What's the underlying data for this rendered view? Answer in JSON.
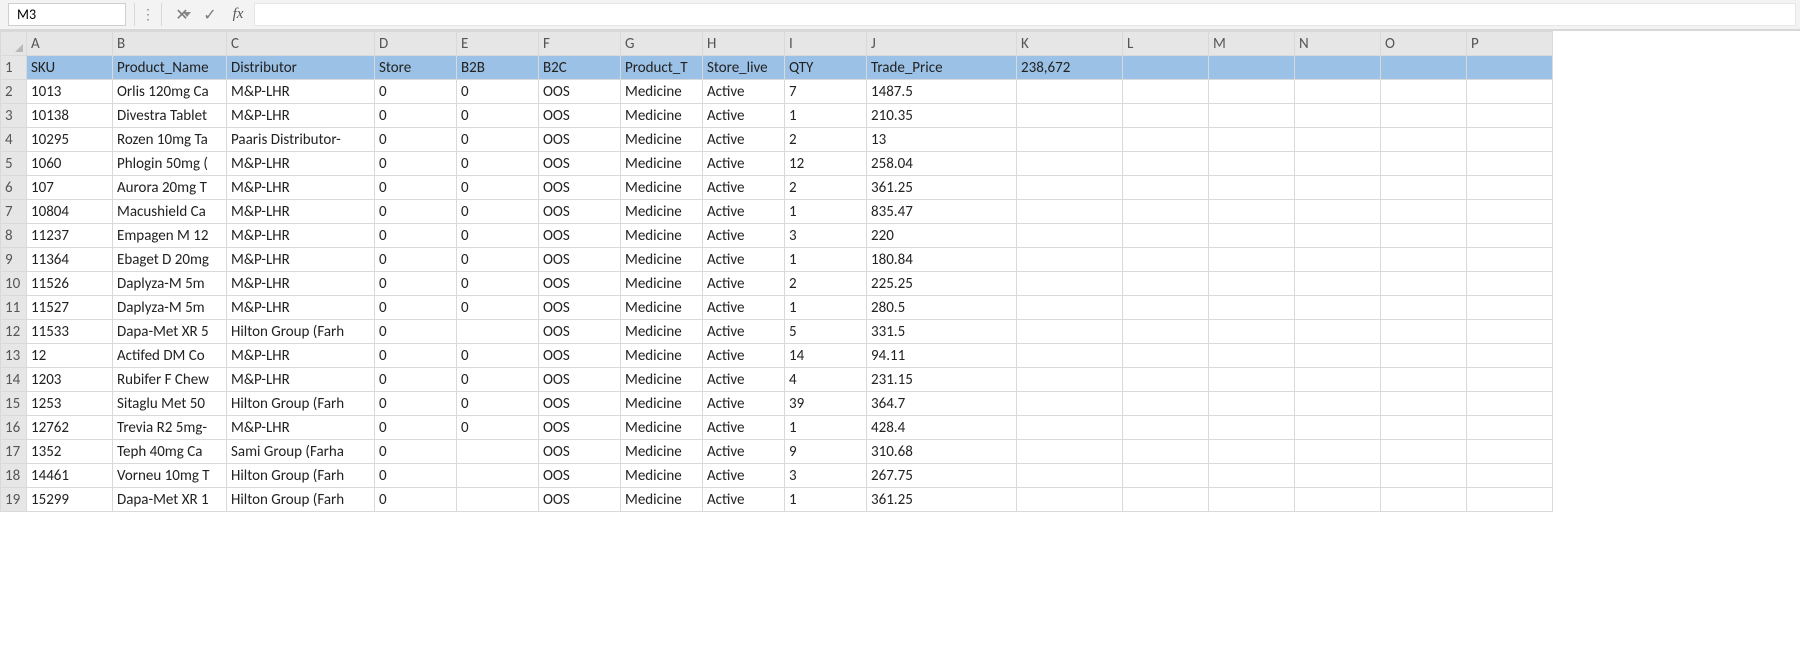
{
  "formula_bar": {
    "name_box_value": "M3",
    "cancel_glyph": "✕",
    "enter_glyph": "✓",
    "fx_label": "fx",
    "formula_value": ""
  },
  "columns": [
    "A",
    "B",
    "C",
    "D",
    "E",
    "F",
    "G",
    "H",
    "I",
    "J",
    "K",
    "L",
    "M",
    "N",
    "O",
    "P"
  ],
  "header_row": {
    "A": "SKU",
    "B": "Product_Name",
    "C": "Distributor",
    "D": "Store",
    "E": "B2B",
    "F": "B2C",
    "G": "Product_T",
    "H": "Store_live",
    "I": "QTY",
    "J": "Trade_Price",
    "K": "238,672"
  },
  "rows": [
    {
      "n": 2,
      "A": "1013",
      "B": "Orlis 120mg Ca",
      "C": "M&P-LHR",
      "D": "0",
      "E": "0",
      "F": "OOS",
      "G": "Medicine",
      "H": "Active",
      "I": "7",
      "J": "1487.5"
    },
    {
      "n": 3,
      "A": "10138",
      "B": "Divestra Tablet",
      "C": "M&P-LHR",
      "D": "0",
      "E": "0",
      "F": "OOS",
      "G": "Medicine",
      "H": "Active",
      "I": "1",
      "J": "210.35"
    },
    {
      "n": 4,
      "A": "10295",
      "B": "Rozen 10mg Ta",
      "C": "Paaris Distributor-",
      "D": "0",
      "E": "0",
      "F": "OOS",
      "G": "Medicine",
      "H": "Active",
      "I": "2",
      "J": "13"
    },
    {
      "n": 5,
      "A": "1060",
      "B": "Phlogin 50mg (",
      "C": "M&P-LHR",
      "D": "0",
      "E": "0",
      "F": "OOS",
      "G": "Medicine",
      "H": "Active",
      "I": "12",
      "J": "258.04"
    },
    {
      "n": 6,
      "A": "107",
      "B": "Aurora 20mg T",
      "C": "M&P-LHR",
      "D": "0",
      "E": "0",
      "F": "OOS",
      "G": "Medicine",
      "H": "Active",
      "I": "2",
      "J": "361.25"
    },
    {
      "n": 7,
      "A": "10804",
      "B": "Macushield Ca",
      "C": "M&P-LHR",
      "D": "0",
      "E": "0",
      "F": "OOS",
      "G": "Medicine",
      "H": "Active",
      "I": "1",
      "J": "835.47"
    },
    {
      "n": 8,
      "A": "11237",
      "B": "Empagen M 12",
      "C": "M&P-LHR",
      "D": "0",
      "E": "0",
      "F": "OOS",
      "G": "Medicine",
      "H": "Active",
      "I": "3",
      "J": "220"
    },
    {
      "n": 9,
      "A": "11364",
      "B": "Ebaget D 20mg",
      "C": "M&P-LHR",
      "D": "0",
      "E": "0",
      "F": "OOS",
      "G": "Medicine",
      "H": "Active",
      "I": "1",
      "J": "180.84"
    },
    {
      "n": 10,
      "A": "11526",
      "B": "Daplyza-M 5m",
      "C": "M&P-LHR",
      "D": "0",
      "E": "0",
      "F": "OOS",
      "G": "Medicine",
      "H": "Active",
      "I": "2",
      "J": "225.25"
    },
    {
      "n": 11,
      "A": "11527",
      "B": "Daplyza-M 5m",
      "C": "M&P-LHR",
      "D": "0",
      "E": "0",
      "F": "OOS",
      "G": "Medicine",
      "H": "Active",
      "I": "1",
      "J": "280.5"
    },
    {
      "n": 12,
      "A": "11533",
      "B": "Dapa-Met XR 5",
      "C": "Hilton Group (Farh",
      "D": "0",
      "E": "",
      "F": "OOS",
      "G": "Medicine",
      "H": "Active",
      "I": "5",
      "J": "331.5"
    },
    {
      "n": 13,
      "A": "12",
      "B": "Actifed DM Co",
      "C": "M&P-LHR",
      "D": "0",
      "E": "0",
      "F": "OOS",
      "G": "Medicine",
      "H": "Active",
      "I": "14",
      "J": "94.11"
    },
    {
      "n": 14,
      "A": "1203",
      "B": "Rubifer F Chew",
      "C": "M&P-LHR",
      "D": "0",
      "E": "0",
      "F": "OOS",
      "G": "Medicine",
      "H": "Active",
      "I": "4",
      "J": "231.15"
    },
    {
      "n": 15,
      "A": "1253",
      "B": "Sitaglu Met 50",
      "C": "Hilton Group (Farh",
      "D": "0",
      "E": "0",
      "F": "OOS",
      "G": "Medicine",
      "H": "Active",
      "I": "39",
      "J": "364.7"
    },
    {
      "n": 16,
      "A": "12762",
      "B": "Trevia R2 5mg-",
      "C": "M&P-LHR",
      "D": "0",
      "E": "0",
      "F": "OOS",
      "G": "Medicine",
      "H": "Active",
      "I": "1",
      "J": "428.4"
    },
    {
      "n": 17,
      "A": "1352",
      "B": "Teph 40mg Ca",
      "C": "Sami Group (Farha",
      "D": "0",
      "E": "",
      "F": "OOS",
      "G": "Medicine",
      "H": "Active",
      "I": "9",
      "J": "310.68"
    },
    {
      "n": 18,
      "A": "14461",
      "B": "Vorneu 10mg T",
      "C": "Hilton Group (Farh",
      "D": "0",
      "E": "",
      "F": "OOS",
      "G": "Medicine",
      "H": "Active",
      "I": "3",
      "J": "267.75"
    },
    {
      "n": 19,
      "A": "15299",
      "B": "Dapa-Met XR 1",
      "C": "Hilton Group (Farh",
      "D": "0",
      "E": "",
      "F": "OOS",
      "G": "Medicine",
      "H": "Active",
      "I": "1",
      "J": "361.25"
    }
  ]
}
